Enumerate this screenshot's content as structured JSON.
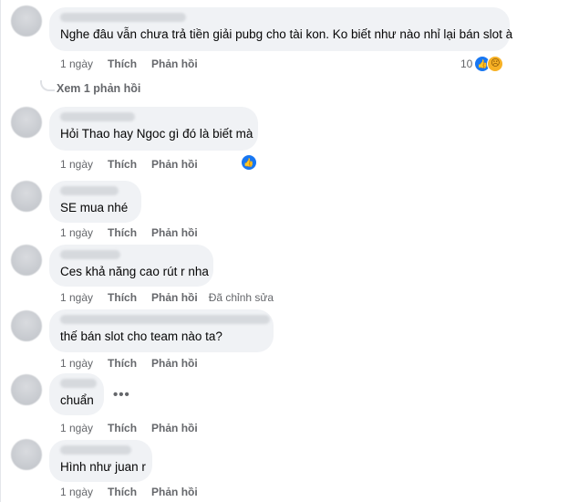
{
  "comments": [
    {
      "text": "Nghe đâu vẫn chưa trả tiền giải pubg cho tài kon. Ko biết như nào nhỉ lại bán slot à",
      "time": "1 ngày",
      "like": "Thích",
      "reply": "Phản hồi",
      "reaction_count": "10",
      "reactions": [
        "like-icon",
        "sad-icon"
      ]
    },
    {
      "text": "Hỏi Thao hay Ngoc gì đó là biết mà",
      "time": "1 ngày",
      "like": "Thích",
      "reply": "Phản hồi",
      "reactions": [
        "like-icon"
      ]
    },
    {
      "text": "SE mua nhé",
      "time": "1 ngày",
      "like": "Thích",
      "reply": "Phản hồi"
    },
    {
      "text": "Ces khả năng cao rút r nha",
      "time": "1 ngày",
      "like": "Thích",
      "reply": "Phản hồi",
      "edited": "Đã chỉnh sửa"
    },
    {
      "text": "thế bán slot cho team nào ta?",
      "time": "1 ngày",
      "like": "Thích",
      "reply": "Phản hồi"
    },
    {
      "text": "chuẩn",
      "time": "1 ngày",
      "like": "Thích",
      "reply": "Phản hồi",
      "more": "•••"
    },
    {
      "text": "Hình như juan r",
      "time": "1 ngày",
      "like": "Thích",
      "reply": "Phản hồi"
    }
  ],
  "view_replies": "Xem 1 phản hồi",
  "colors": {
    "like_blue": "#1877f2",
    "sad_yellow": "#f7b125",
    "bubble": "#f0f2f5",
    "meta": "#65676b"
  }
}
